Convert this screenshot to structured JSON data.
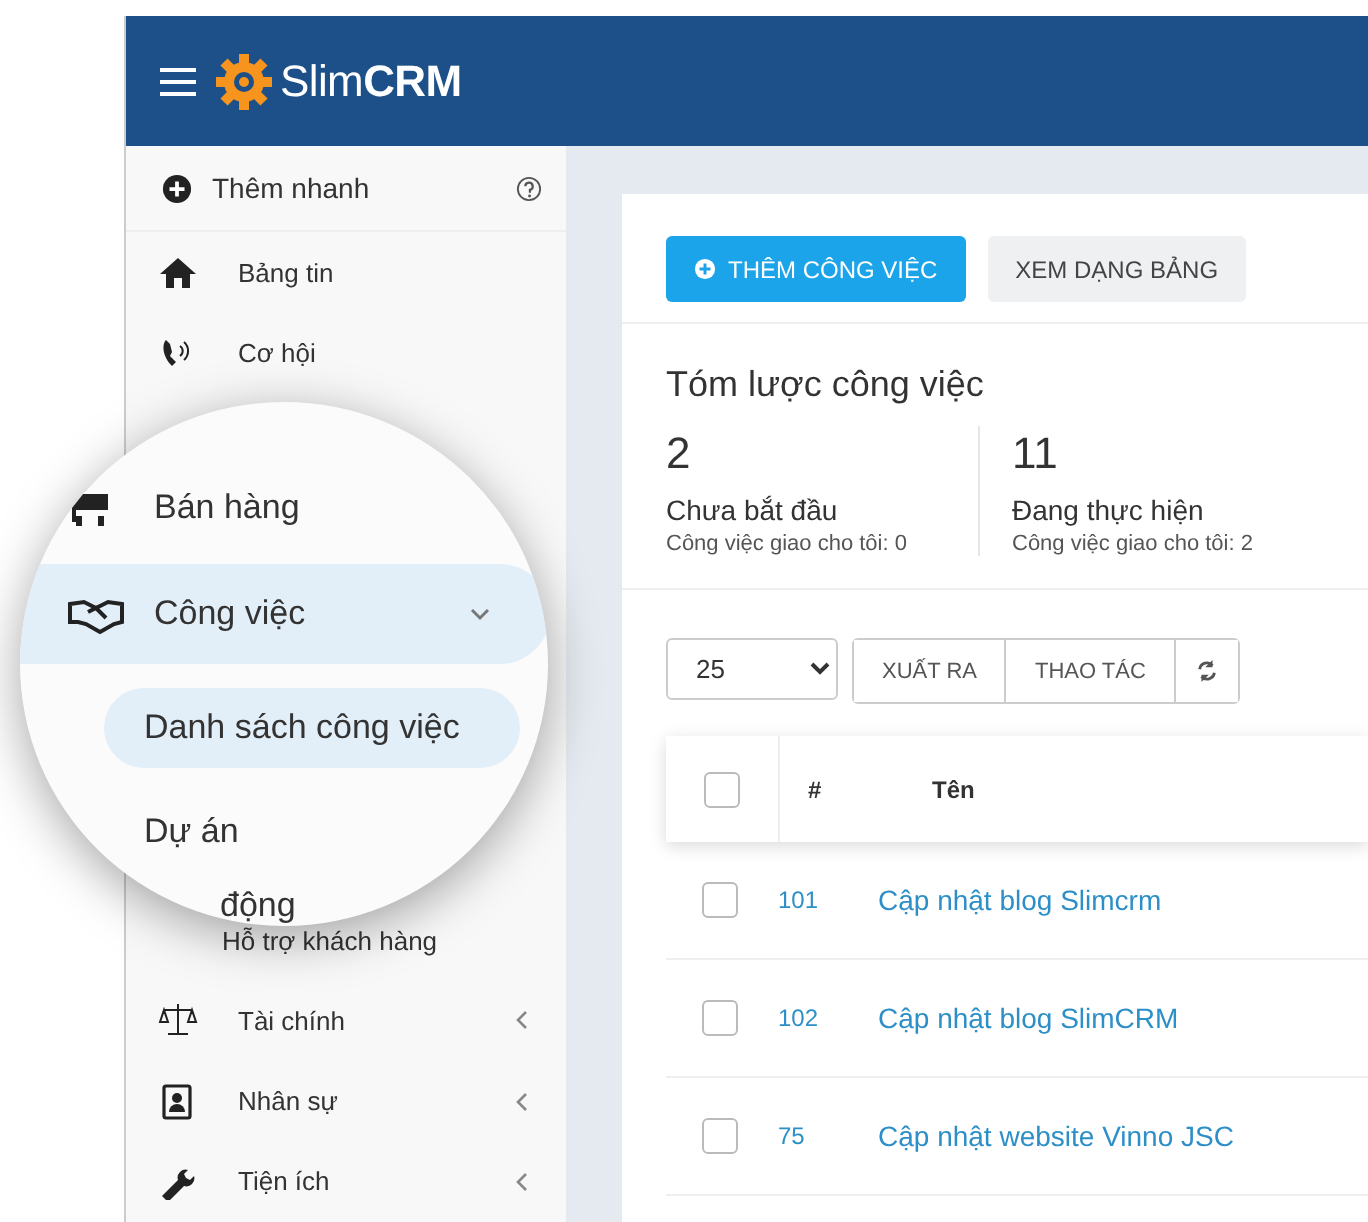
{
  "header": {
    "logo": "Slim**CRM**"
  },
  "sidebar": {
    "quick_add": {
      "label": "Thêm nhanh"
    },
    "top_items": [
      {
        "label": "Bảng tin"
      },
      {
        "label": "Cơ hội"
      }
    ],
    "bottom_items": [
      {
        "label": "Hỗ trợ khách hàng",
        "kind": "sub"
      },
      {
        "label": "Tài chính",
        "kind": "menu",
        "expanded": false
      },
      {
        "label": "Nhân sự",
        "kind": "menu",
        "expanded": false
      },
      {
        "label": "Tiện ích",
        "kind": "menu",
        "expanded": false
      }
    ]
  },
  "magnifier": {
    "items": [
      {
        "label": "Bán hàng",
        "kind": "menu",
        "selected": false
      },
      {
        "label": "Công việc",
        "kind": "menu",
        "selected": true,
        "expanded": true
      },
      {
        "label": "Danh sách công việc",
        "kind": "submenu",
        "selected": true
      },
      {
        "label": "Dự án",
        "kind": "submenu",
        "selected": false
      },
      {
        "label": "động",
        "kind": "partial",
        "selected": false
      }
    ]
  },
  "toolbar": {
    "buttons": [
      {
        "label": "THÊM CÔNG VIỆC",
        "kind": "primary"
      },
      {
        "label": "XEM DẠNG BẢNG",
        "kind": "secondary"
      }
    ]
  },
  "summary": {
    "title": "Tóm lược công việc",
    "stats": [
      {
        "count": "2",
        "label": "Chưa bắt đầu",
        "note": "Công việc giao cho tôi: 0"
      },
      {
        "count": "11",
        "label": "Đang thực hiện",
        "note": "Công việc giao cho tôi: 2"
      }
    ]
  },
  "table_controls": {
    "page_size": "25",
    "buttons": [
      "XUẤT RA",
      "THAO TÁC"
    ]
  },
  "table": {
    "columns": [
      "#",
      "Tên"
    ],
    "header_checked": false,
    "rows": [
      {
        "id": "101",
        "name": "Cập nhật blog Slimcrm",
        "checked": false
      },
      {
        "id": "102",
        "name": "Cập nhật blog SlimCRM",
        "checked": false
      },
      {
        "id": "75",
        "name": "Cập nhật website Vinno JSC",
        "checked": false
      }
    ]
  }
}
